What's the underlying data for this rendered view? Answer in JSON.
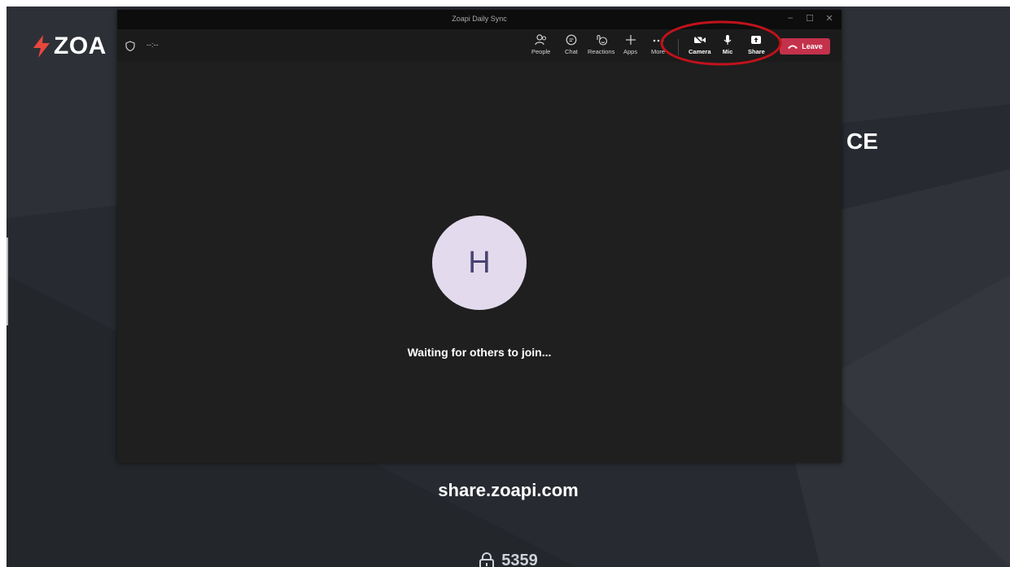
{
  "background": {
    "brand_name": "ZOA",
    "partial_text": "CE",
    "share_domain": "share.zoapi.com",
    "room_code": "5359",
    "colors": {
      "bg": "#272a30",
      "brand_bolt": "#e8473f"
    }
  },
  "window": {
    "title": "Zoapi Daily Sync",
    "timer": "--:--",
    "controls": [
      "minimize",
      "maximize",
      "close"
    ]
  },
  "toolbar": {
    "people_label": "People",
    "chat_label": "Chat",
    "reactions_label": "Reactions",
    "apps_label": "Apps",
    "more_label": "More",
    "camera_label": "Camera",
    "mic_label": "Mic",
    "share_label": "Share",
    "leave_label": "Leave",
    "colors": {
      "leave": "#c4314b"
    }
  },
  "stage": {
    "avatar_initial": "H",
    "status_text": "Waiting for others to join...",
    "colors": {
      "avatar_bg": "#e3dbed",
      "avatar_text": "#4a4270"
    }
  },
  "annotation": {
    "shape": "ellipse",
    "color": "#c0121b"
  }
}
